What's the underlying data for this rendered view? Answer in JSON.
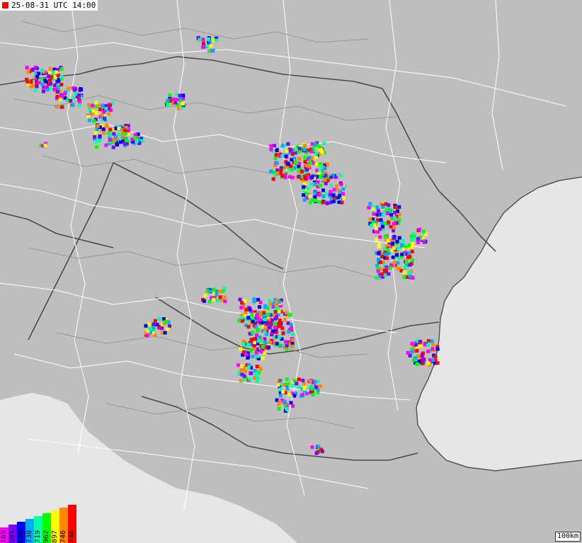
{
  "header": {
    "timestamp": "25-08-31 UTC 14:00",
    "marker_color": "#ff0000"
  },
  "scale_label": "100km",
  "legend": [
    {
      "count": "165",
      "color": "#ff00ff"
    },
    {
      "count": "591",
      "color": "#8000ff"
    },
    {
      "count": "628",
      "color": "#0000ff"
    },
    {
      "count": "730",
      "color": "#00aaff"
    },
    {
      "count": "719",
      "color": "#00ffaa"
    },
    {
      "count": "962",
      "color": "#00ff00"
    },
    {
      "count": "897",
      "color": "#ffff00"
    },
    {
      "count": "746",
      "color": "#ff8800"
    },
    {
      "count": "746",
      "color": "#ff0000"
    }
  ],
  "colors": {
    "sea": "#e6e6e6",
    "land": "#bebebe",
    "border": "#555555",
    "road": "#ffffff"
  }
}
